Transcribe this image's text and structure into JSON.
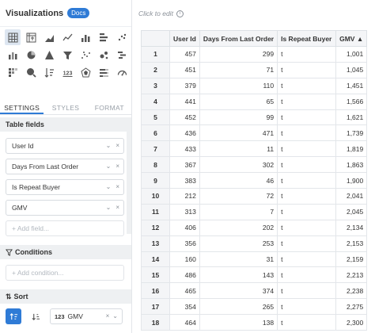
{
  "header": {
    "title": "Visualizations",
    "docs_badge": "Docs"
  },
  "viz_icons": [
    "table-icon",
    "pivot-table-icon",
    "area-chart-icon",
    "line-chart-icon",
    "bar-chart-icon",
    "horizontal-bar-chart-icon",
    "scatter-icon",
    "stacked-bar-icon",
    "pie-chart-icon",
    "pyramid-icon",
    "funnel-icon",
    "dot-plot-icon",
    "bubble-icon",
    "timeline-icon",
    "cohort-icon",
    "map-search-icon",
    "sort-list-icon",
    "number-icon",
    "radar-icon",
    "progress-bars-icon",
    "gauge-icon"
  ],
  "tabs": [
    "SETTINGS",
    "STYLES",
    "FORMAT"
  ],
  "table_fields": {
    "heading": "Table fields",
    "items": [
      "User Id",
      "Days From Last Order",
      "Is Repeat Buyer",
      "GMV"
    ],
    "add_placeholder": "+ Add field..."
  },
  "conditions": {
    "heading": "Conditions",
    "add_placeholder": "+ Add condition..."
  },
  "sort": {
    "heading": "Sort",
    "type_badge": "123",
    "field": "GMV"
  },
  "canvas": {
    "click_to_edit": "Click to edit",
    "info": "i"
  },
  "table": {
    "columns": [
      "",
      "User Id",
      "Days From Last Order",
      "Is Repeat Buyer",
      "GMV ▲"
    ],
    "rows": [
      [
        "1",
        "457",
        "299",
        "t",
        "1,001"
      ],
      [
        "2",
        "451",
        "71",
        "t",
        "1,045"
      ],
      [
        "3",
        "379",
        "110",
        "t",
        "1,451"
      ],
      [
        "4",
        "441",
        "65",
        "t",
        "1,566"
      ],
      [
        "5",
        "452",
        "99",
        "t",
        "1,621"
      ],
      [
        "6",
        "436",
        "471",
        "t",
        "1,739"
      ],
      [
        "7",
        "433",
        "11",
        "t",
        "1,819"
      ],
      [
        "8",
        "367",
        "302",
        "t",
        "1,863"
      ],
      [
        "9",
        "383",
        "46",
        "t",
        "1,900"
      ],
      [
        "10",
        "212",
        "72",
        "t",
        "2,041"
      ],
      [
        "11",
        "313",
        "7",
        "t",
        "2,045"
      ],
      [
        "12",
        "406",
        "202",
        "t",
        "2,134"
      ],
      [
        "13",
        "356",
        "253",
        "t",
        "2,153"
      ],
      [
        "14",
        "160",
        "31",
        "t",
        "2,159"
      ],
      [
        "15",
        "486",
        "143",
        "t",
        "2,213"
      ],
      [
        "16",
        "465",
        "374",
        "t",
        "2,238"
      ],
      [
        "17",
        "354",
        "265",
        "t",
        "2,275"
      ],
      [
        "18",
        "464",
        "138",
        "t",
        "2,300"
      ]
    ]
  },
  "colors": {
    "accent": "#2f7bd6",
    "selected_icon_bg": "#dde6f1",
    "section_bg": "#eef0f2"
  }
}
